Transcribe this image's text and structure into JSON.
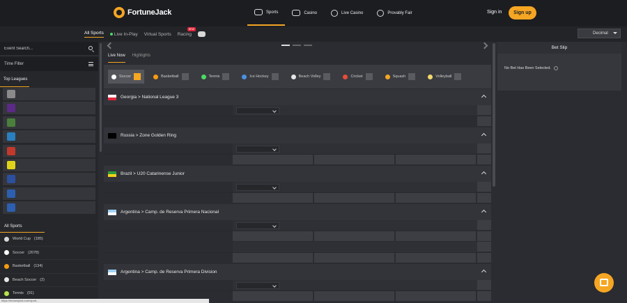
{
  "header": {
    "logo_text": "FortuneJack",
    "nav": [
      {
        "label": "Sports",
        "icon": "sports-icon",
        "active": true
      },
      {
        "label": "Casino",
        "icon": "casino-icon",
        "active": false
      },
      {
        "label": "Live Casino",
        "icon": "live-casino-icon",
        "active": false
      },
      {
        "label": "Provably Fair",
        "icon": "provably-fair-icon",
        "active": false
      }
    ],
    "signin": "Sign in",
    "signup": "Sign up"
  },
  "subnav": {
    "items": [
      "All Sports",
      "Live In-Play",
      "Virtual Sports",
      "Racing"
    ],
    "new_badge": "NEW",
    "odds_format": "Decimal"
  },
  "sidebar": {
    "search_placeholder": "Event Search...",
    "time_filter": "Time Filter",
    "top_leagues_title": "Top Leagues",
    "top_leagues_icon_colors": [
      "#8a8a8a",
      "#5b2a86",
      "#4b7f3c",
      "#2a7fbf",
      "#c0392b",
      "#e0d21b",
      "#2c4f9e",
      "#2c5fb0",
      "#2c5fb0"
    ],
    "all_sports_title": "All Sports",
    "sports": [
      {
        "label": "World Cup",
        "count": "(185)",
        "icon": "trophy-icon",
        "color": "#d8d8d8"
      },
      {
        "label": "Soccer",
        "count": "(2078)",
        "icon": "soccer-ball-icon",
        "color": "#ffffff"
      },
      {
        "label": "Basketball",
        "count": "(134)",
        "icon": "basketball-icon",
        "color": "#f39c12"
      },
      {
        "label": "Beach Soccer",
        "count": "(2)",
        "icon": "beach-soccer-icon",
        "color": "#e6e6e6"
      },
      {
        "label": "Tennis",
        "count": "(91)",
        "icon": "tennis-icon",
        "color": "#b6e34a"
      }
    ]
  },
  "main": {
    "tabs": [
      "Live Now",
      "Highlights"
    ],
    "sport_filters": [
      "Soccer",
      "Basketball",
      "Tennis",
      "Ice Hockey",
      "Beach Volley",
      "Cricket",
      "Squash",
      "Volleyball"
    ],
    "sport_filter_colors": [
      "#ffffff",
      "#f39c12",
      "#4cd964",
      "#4a90e2",
      "#e6e6e6",
      "#e74c3c",
      "#f5a623",
      "#f5d76e"
    ],
    "leagues": [
      {
        "title": "Georgia > National League 3",
        "flag_colors": [
          "#ffffff",
          "#e0263b"
        ],
        "rows": 1
      },
      {
        "title": "Russia > Zone Golden Ring",
        "flag_colors": [
          "#000000",
          "#000000"
        ],
        "rows": 1
      },
      {
        "title": "Brazil > U20 Catarinense Junior",
        "flag_colors": [
          "#2e9b3f",
          "#f5d21b"
        ],
        "rows": 1
      },
      {
        "title": "Argentina > Camp. de Reserva Primera Nacional",
        "flag_colors": [
          "#9fd1f2",
          "#ffffff"
        ],
        "rows": 2
      },
      {
        "title": "Argentina > Camp. de Reserva Primera Division",
        "flag_colors": [
          "#9fd1f2",
          "#ffffff"
        ],
        "rows": 1
      }
    ]
  },
  "betslip": {
    "title": "Bet Slip",
    "empty_message": "No Bet Has Been Selected."
  },
  "status_url": "https://fortunejack.com/sport..."
}
